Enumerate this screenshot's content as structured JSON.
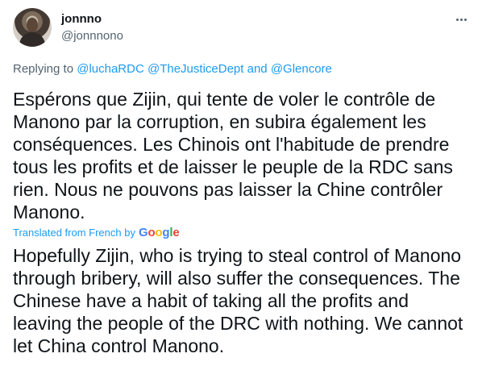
{
  "author": {
    "display_name": "jonnno",
    "handle": "@jonnnono"
  },
  "more_icon": "more-horizontal-icon",
  "reply": {
    "prefix": "Replying to ",
    "mention1": "@luchaRDC",
    "mention2": "@TheJusticeDept",
    "and": " and ",
    "mention3": "@Glencore"
  },
  "tweet": {
    "original_text": "Espérons que Zijin, qui tente de voler le contrôle de\nManono par la corruption, en subira également les\nconséquences. Les Chinois ont l'habitude de prendre\ntous les profits et de laisser le peuple de la RDC sans\nrien. Nous ne pouvons pas laisser la Chine contrôler\nManono.",
    "translated_label": "Translated from French by",
    "translation_provider_letters": [
      "G",
      "o",
      "o",
      "g",
      "l",
      "e"
    ],
    "translation_text": "Hopefully Zijin, who is trying to steal control of Manono\nthrough bribery, will also suffer the consequences. The\nChinese have a habit of taking all the profits and\nleaving the people of the DRC with nothing. We cannot\nlet China control Manono."
  },
  "colors": {
    "link": "#1d9bf0",
    "secondary_text": "#536471",
    "primary_text": "#0f1419"
  }
}
